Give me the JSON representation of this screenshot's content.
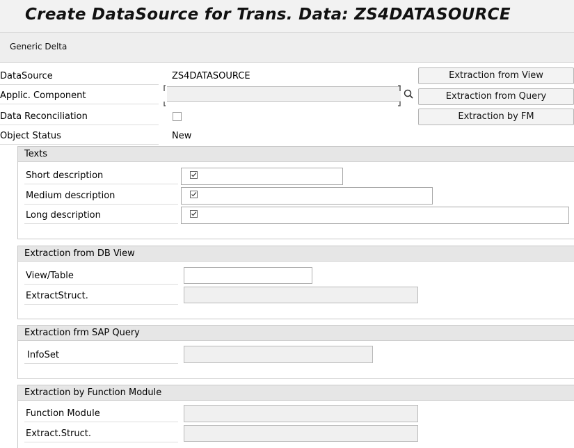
{
  "title": "Create DataSource for Trans. Data: ZS4DATASOURCE",
  "toolbar": {
    "generic_delta": "Generic Delta"
  },
  "header": {
    "datasource_label": "DataSource",
    "datasource_value": "ZS4DATASOURCE",
    "applic_component_label": "Applic. Component",
    "applic_component_value": "",
    "data_reconciliation_label": "Data Reconciliation",
    "object_status_label": "Object Status",
    "object_status_value": "New"
  },
  "buttons": {
    "extraction_view": "Extraction from View",
    "extraction_query": "Extraction from Query",
    "extraction_fm": "Extraction by FM"
  },
  "texts": {
    "group_title": "Texts",
    "short_label": "Short description",
    "medium_label": "Medium description",
    "long_label": "Long description",
    "short_value": "",
    "medium_value": "",
    "long_value": ""
  },
  "db_view": {
    "group_title": "Extraction from DB View",
    "view_table_label": "View/Table",
    "view_table_value": "",
    "extract_struct_label": "ExtractStruct.",
    "extract_struct_value": ""
  },
  "sap_query": {
    "group_title": "Extraction frm SAP Query",
    "infoset_label": "InfoSet",
    "infoset_value": ""
  },
  "function_module": {
    "group_title": "Extraction by Function Module",
    "fm_label": "Function Module",
    "fm_value": "",
    "extract_struct_label": "Extract.Struct.",
    "extract_struct_value": ""
  },
  "colors": {
    "title_bg": "#f2f2f2",
    "group_header_bg": "#e6e6e6",
    "readonly_field_bg": "#f0f0f0",
    "button_bg": "#f3f3f3"
  }
}
